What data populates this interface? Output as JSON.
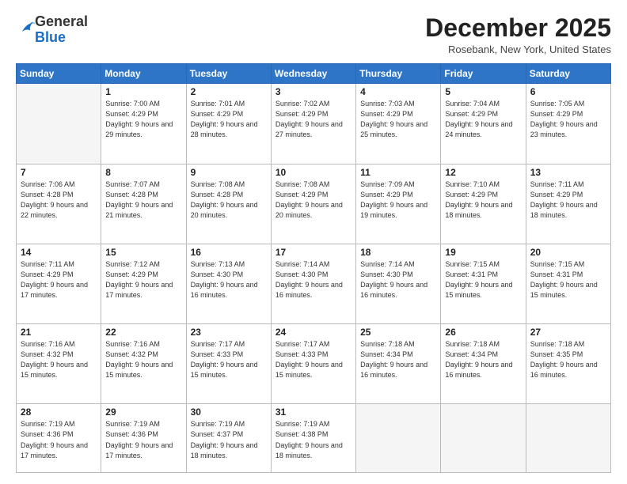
{
  "logo": {
    "general": "General",
    "blue": "Blue"
  },
  "header": {
    "month": "December 2025",
    "location": "Rosebank, New York, United States"
  },
  "weekdays": [
    "Sunday",
    "Monday",
    "Tuesday",
    "Wednesday",
    "Thursday",
    "Friday",
    "Saturday"
  ],
  "weeks": [
    [
      {
        "day": "",
        "info": "",
        "empty": true
      },
      {
        "day": "1",
        "info": "Sunrise: 7:00 AM\nSunset: 4:29 PM\nDaylight: 9 hours\nand 29 minutes."
      },
      {
        "day": "2",
        "info": "Sunrise: 7:01 AM\nSunset: 4:29 PM\nDaylight: 9 hours\nand 28 minutes."
      },
      {
        "day": "3",
        "info": "Sunrise: 7:02 AM\nSunset: 4:29 PM\nDaylight: 9 hours\nand 27 minutes."
      },
      {
        "day": "4",
        "info": "Sunrise: 7:03 AM\nSunset: 4:29 PM\nDaylight: 9 hours\nand 25 minutes."
      },
      {
        "day": "5",
        "info": "Sunrise: 7:04 AM\nSunset: 4:29 PM\nDaylight: 9 hours\nand 24 minutes."
      },
      {
        "day": "6",
        "info": "Sunrise: 7:05 AM\nSunset: 4:29 PM\nDaylight: 9 hours\nand 23 minutes."
      }
    ],
    [
      {
        "day": "7",
        "info": "Sunrise: 7:06 AM\nSunset: 4:28 PM\nDaylight: 9 hours\nand 22 minutes."
      },
      {
        "day": "8",
        "info": "Sunrise: 7:07 AM\nSunset: 4:28 PM\nDaylight: 9 hours\nand 21 minutes."
      },
      {
        "day": "9",
        "info": "Sunrise: 7:08 AM\nSunset: 4:28 PM\nDaylight: 9 hours\nand 20 minutes."
      },
      {
        "day": "10",
        "info": "Sunrise: 7:08 AM\nSunset: 4:29 PM\nDaylight: 9 hours\nand 20 minutes."
      },
      {
        "day": "11",
        "info": "Sunrise: 7:09 AM\nSunset: 4:29 PM\nDaylight: 9 hours\nand 19 minutes."
      },
      {
        "day": "12",
        "info": "Sunrise: 7:10 AM\nSunset: 4:29 PM\nDaylight: 9 hours\nand 18 minutes."
      },
      {
        "day": "13",
        "info": "Sunrise: 7:11 AM\nSunset: 4:29 PM\nDaylight: 9 hours\nand 18 minutes."
      }
    ],
    [
      {
        "day": "14",
        "info": "Sunrise: 7:11 AM\nSunset: 4:29 PM\nDaylight: 9 hours\nand 17 minutes."
      },
      {
        "day": "15",
        "info": "Sunrise: 7:12 AM\nSunset: 4:29 PM\nDaylight: 9 hours\nand 17 minutes."
      },
      {
        "day": "16",
        "info": "Sunrise: 7:13 AM\nSunset: 4:30 PM\nDaylight: 9 hours\nand 16 minutes."
      },
      {
        "day": "17",
        "info": "Sunrise: 7:14 AM\nSunset: 4:30 PM\nDaylight: 9 hours\nand 16 minutes."
      },
      {
        "day": "18",
        "info": "Sunrise: 7:14 AM\nSunset: 4:30 PM\nDaylight: 9 hours\nand 16 minutes."
      },
      {
        "day": "19",
        "info": "Sunrise: 7:15 AM\nSunset: 4:31 PM\nDaylight: 9 hours\nand 15 minutes."
      },
      {
        "day": "20",
        "info": "Sunrise: 7:15 AM\nSunset: 4:31 PM\nDaylight: 9 hours\nand 15 minutes."
      }
    ],
    [
      {
        "day": "21",
        "info": "Sunrise: 7:16 AM\nSunset: 4:32 PM\nDaylight: 9 hours\nand 15 minutes."
      },
      {
        "day": "22",
        "info": "Sunrise: 7:16 AM\nSunset: 4:32 PM\nDaylight: 9 hours\nand 15 minutes."
      },
      {
        "day": "23",
        "info": "Sunrise: 7:17 AM\nSunset: 4:33 PM\nDaylight: 9 hours\nand 15 minutes."
      },
      {
        "day": "24",
        "info": "Sunrise: 7:17 AM\nSunset: 4:33 PM\nDaylight: 9 hours\nand 15 minutes."
      },
      {
        "day": "25",
        "info": "Sunrise: 7:18 AM\nSunset: 4:34 PM\nDaylight: 9 hours\nand 16 minutes."
      },
      {
        "day": "26",
        "info": "Sunrise: 7:18 AM\nSunset: 4:34 PM\nDaylight: 9 hours\nand 16 minutes."
      },
      {
        "day": "27",
        "info": "Sunrise: 7:18 AM\nSunset: 4:35 PM\nDaylight: 9 hours\nand 16 minutes."
      }
    ],
    [
      {
        "day": "28",
        "info": "Sunrise: 7:19 AM\nSunset: 4:36 PM\nDaylight: 9 hours\nand 17 minutes."
      },
      {
        "day": "29",
        "info": "Sunrise: 7:19 AM\nSunset: 4:36 PM\nDaylight: 9 hours\nand 17 minutes."
      },
      {
        "day": "30",
        "info": "Sunrise: 7:19 AM\nSunset: 4:37 PM\nDaylight: 9 hours\nand 18 minutes."
      },
      {
        "day": "31",
        "info": "Sunrise: 7:19 AM\nSunset: 4:38 PM\nDaylight: 9 hours\nand 18 minutes."
      },
      {
        "day": "",
        "info": "",
        "empty": true
      },
      {
        "day": "",
        "info": "",
        "empty": true
      },
      {
        "day": "",
        "info": "",
        "empty": true
      }
    ]
  ]
}
